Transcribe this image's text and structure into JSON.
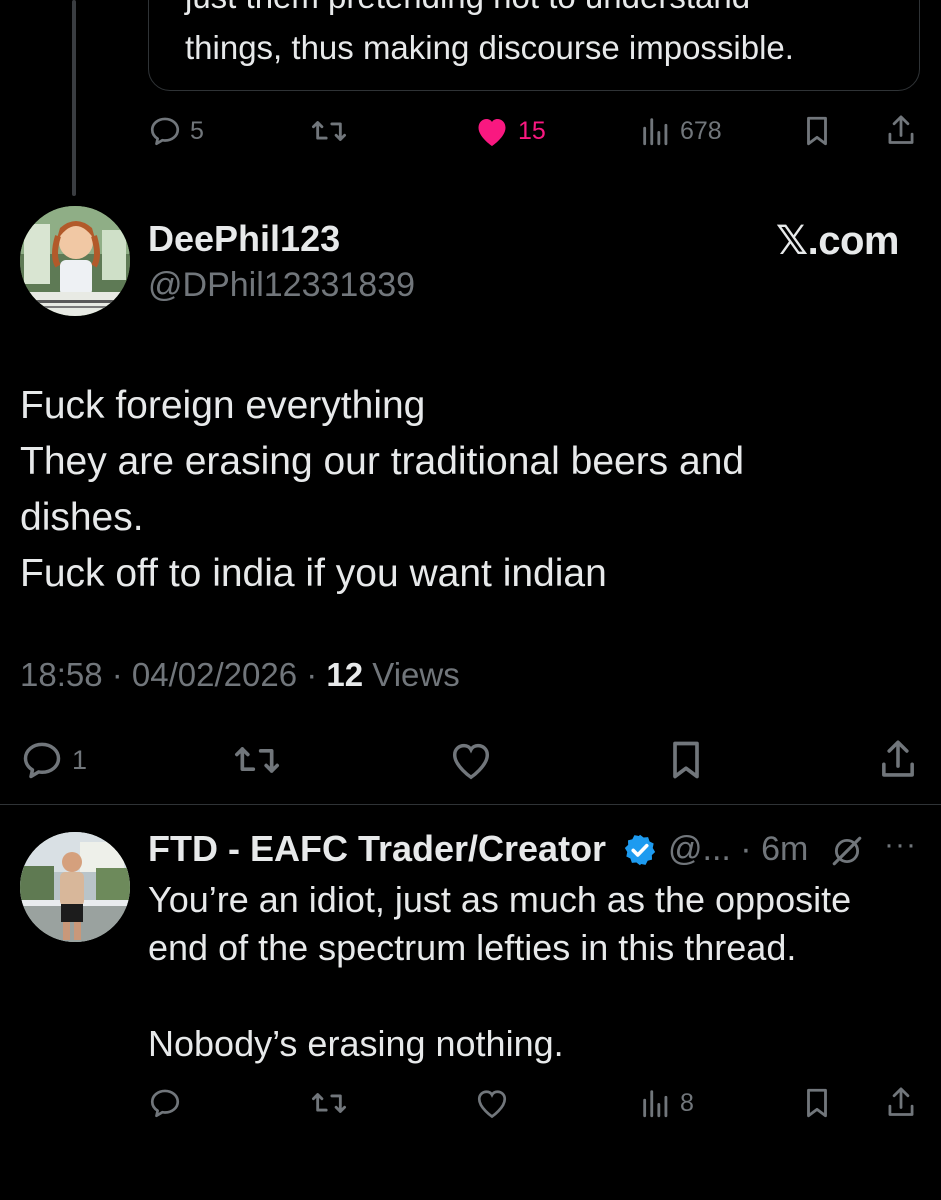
{
  "quoted": {
    "text_line_cut": "just them pretending not to understand",
    "text_line": "things, thus making discourse impossible."
  },
  "quoted_actions": {
    "replies": "5",
    "likes": "15",
    "views": "678",
    "liked": true,
    "like_color": "#f91880"
  },
  "tweet": {
    "display_name": "DeePhil123",
    "handle": "@DPhil12331839",
    "watermark": "𝕏.com",
    "body_lines": [
      "Fuck foreign everything",
      "They are erasing our traditional beers and",
      "dishes.",
      "Fuck off to india if you want indian"
    ],
    "timestamp": "18:58 · 04/02/2026 · ",
    "views_count": "12",
    "views_label": " Views",
    "replies": "1"
  },
  "reply": {
    "display_name": "FTD - EAFC Trader/Creator",
    "handle_time": "@... · 6m",
    "more": "···",
    "body_lines": [
      "You’re an idiot, just as much as the opposite",
      "end of the spectrum lefties in this thread.",
      "",
      "Nobody’s erasing nothing."
    ],
    "views": "8",
    "verified_color": "#1d9bf0"
  },
  "icons": [
    "reply-icon",
    "retweet-icon",
    "heart-icon",
    "views-icon",
    "bookmark-icon",
    "share-icon",
    "verified-badge-icon",
    "grok-icon",
    "more-icon"
  ],
  "colors": {
    "background": "#000000",
    "text": "#e7e9ea",
    "muted": "#71767b",
    "border": "#2f3336"
  }
}
